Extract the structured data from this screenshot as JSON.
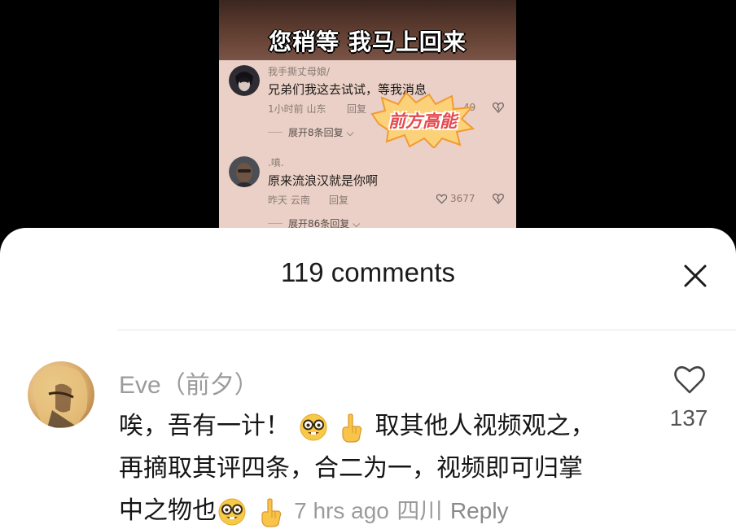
{
  "video": {
    "banner_text": "您稍等 我马上回来",
    "sticker_text": "前方高能",
    "comments": [
      {
        "username": "我手撕丈母娘/",
        "text": "兄弟们我这去试试，等我消息",
        "time": "1小时前",
        "location": "山东",
        "reply_label": "回复",
        "likes": "49",
        "expand_label": "展开8条回复"
      },
      {
        "username": ".嗔.",
        "text": "原来流浪汉就是你啊",
        "time": "昨天",
        "location": "云南",
        "reply_label": "回复",
        "likes": "3677",
        "expand_label": "展开86条回复"
      }
    ]
  },
  "sheet": {
    "title": "119 comments",
    "close_icon": "close-icon"
  },
  "comment": {
    "author": "Eve（前夕）",
    "line1_a": "唉，吾有一计！",
    "line1_b": "取其他人视频观之，",
    "line2": "再摘取其评四条，合二为一，视频即可归掌",
    "line3": "中之物也",
    "time": "7 hrs ago",
    "location": "四川",
    "reply_label": "Reply",
    "likes": "137",
    "emoji_icons": [
      "nerd-face-emoji",
      "pointing-up-emoji"
    ]
  }
}
